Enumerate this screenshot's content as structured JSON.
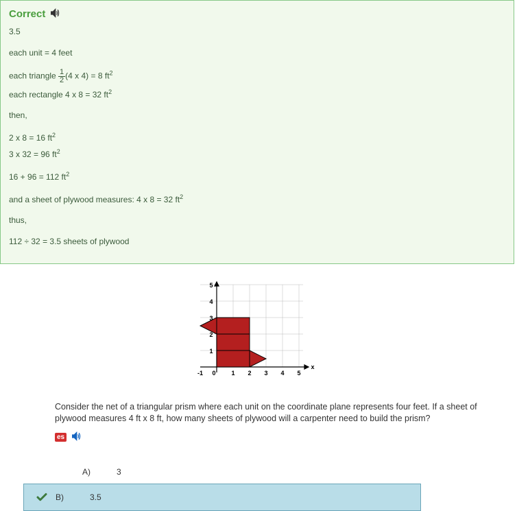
{
  "correct": {
    "title": "Correct",
    "answer_value": "3.5",
    "lines": {
      "unit": "each unit = 4 feet",
      "tri_pre": "each triangle ",
      "tri_post": "(4 x 4) = 8 ft",
      "rect": "each rectangle 4 x 8 = 32 ft",
      "then": "then,",
      "calc1": "2 x 8 = 16 ft",
      "calc2": "3 x 32 = 96 ft",
      "sum": "16 + 96 = 112 ft",
      "sheet": "and a sheet of plywood measures: 4 x 8 = 32 ft",
      "thus": "thus,",
      "final": "112 ÷ 32 = 3.5 sheets of plywood"
    },
    "frac": {
      "num": "1",
      "den": "2"
    },
    "sq": "2"
  },
  "chart_data": {
    "type": "scatter",
    "title": "",
    "xlabel": "x",
    "ylabel": "",
    "xlim": [
      -1,
      5
    ],
    "ylim": [
      0,
      5
    ],
    "x_ticks": [
      "-1",
      "0",
      "1",
      "2",
      "3",
      "4",
      "5"
    ],
    "y_ticks": [
      "0",
      "1",
      "2",
      "3",
      "4",
      "5"
    ],
    "shape_vertices": [
      [
        0,
        3
      ],
      [
        2,
        3
      ],
      [
        2,
        1
      ],
      [
        3,
        0.5
      ],
      [
        2,
        0
      ],
      [
        0,
        0
      ],
      [
        0,
        2
      ],
      [
        -1,
        2.5
      ],
      [
        0,
        3
      ]
    ],
    "interior_segments": [
      [
        [
          0,
          2
        ],
        [
          2,
          2
        ]
      ],
      [
        [
          0,
          1
        ],
        [
          2,
          1
        ]
      ],
      [
        [
          2,
          0
        ],
        [
          2,
          1
        ]
      ]
    ],
    "grid": true
  },
  "question": {
    "text": "Consider the net of a triangular prism where each unit on the coordinate plane represents four feet. If a sheet of plywood measures 4 ft x 8 ft, how many sheets of plywood will a carpenter need to build the prism?",
    "es_label": "es"
  },
  "answers": {
    "a": {
      "letter": "A)",
      "value": "3"
    },
    "b": {
      "letter": "B)",
      "value": "3.5"
    }
  }
}
